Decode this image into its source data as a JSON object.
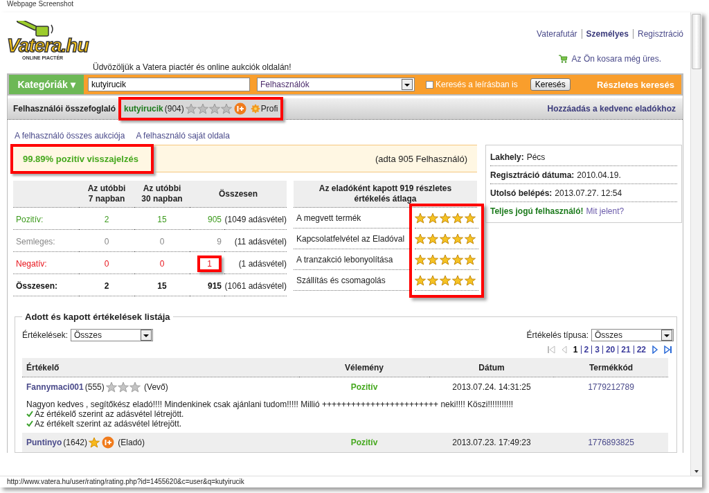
{
  "caption": "Webpage Screenshot",
  "logo": {
    "name": "Vatera.hu",
    "tagline": "ONLINE PIACTÉR"
  },
  "welcome": "Üdvözöljük a Vatera piactér és online aukciók oldalán!",
  "top_links": [
    {
      "label": "Vaterafutár",
      "bold": false
    },
    {
      "label": "Személyes",
      "bold": true
    },
    {
      "label": "Regisztráció",
      "bold": false
    }
  ],
  "cart": "Az Ön kosara még üres.",
  "search": {
    "categories": "Kategóriák ▾",
    "value": "kutyirucik",
    "scope": "Felhasználók",
    "description_checkbox": {
      "label": "Keresés a leírásban is",
      "checked": false
    },
    "button": "Keresés",
    "advanced": "Részletes keresés"
  },
  "summary": {
    "title": "Felhasználói összefoglaló",
    "highlighted": true,
    "user": "kutyirucik",
    "count": "(904)",
    "badges": [
      {
        "kind": "grey_star"
      },
      {
        "kind": "grey_star"
      },
      {
        "kind": "grey_star"
      },
      {
        "kind": "grey_star"
      },
      {
        "kind": "iplus"
      }
    ],
    "profi": "Profi",
    "favorite": "Hozzáadás a kedvenc eladókhoz"
  },
  "user_links": [
    "A felhasználó összes aukciója",
    "A felhasználó saját oldala"
  ],
  "feedback": {
    "headline": "99.89% pozitív visszajelzés",
    "highlighted": true,
    "given_by": "(adta 905 Felhasználó)"
  },
  "stats": {
    "columns": [
      "Az utóbbi 7 napban",
      "Az utóbbi 30 napban",
      "Összesen"
    ],
    "rows": [
      {
        "kind": "positive",
        "label": "Pozitív:",
        "d7": "2",
        "d30": "15",
        "total": "905",
        "sales": "(1049 adásvétel)",
        "highlighted": false
      },
      {
        "kind": "neutral",
        "label": "Semleges:",
        "d7": "0",
        "d30": "0",
        "total": "9",
        "sales": "(11 adásvétel)",
        "highlighted": false
      },
      {
        "kind": "negative",
        "label": "Negatív:",
        "d7": "0",
        "d30": "0",
        "total": "1",
        "sales": "(1 adásvétel)",
        "highlighted": true
      },
      {
        "kind": "total",
        "label": "Összesen:",
        "d7": "2",
        "d30": "15",
        "total": "915",
        "sales": "(1061 adásvétel)",
        "highlighted": false
      }
    ]
  },
  "ratings": {
    "title": "Az eladóként kapott 919 részletes értékelés átlaga",
    "highlighted": true,
    "rows": [
      {
        "label": "A megvett termék",
        "stars": 5
      },
      {
        "label": "Kapcsolatfelvétel az Eladóval",
        "stars": 5
      },
      {
        "label": "A tranzakció lebonyolítása",
        "stars": 5
      },
      {
        "label": "Szállítás és csomagolás",
        "stars": 5
      }
    ]
  },
  "profile": {
    "rows": [
      {
        "label": "Lakhely:",
        "value": "Pécs"
      },
      {
        "label": "Regisztráció dátuma:",
        "value": "2010.04.19."
      },
      {
        "label": "Utolsó belépés:",
        "value": "2013.07.27. 12:54"
      }
    ],
    "status": "Teljes jogú felhasználó!",
    "status_link": "Mit jelent?"
  },
  "list": {
    "title": "Adott és kapott értékelések listája",
    "filter": {
      "label": "Értékelések:",
      "value": "Összes"
    },
    "type_filter": {
      "label": "Értékelés típusa:",
      "value": "Összes"
    },
    "pages": [
      {
        "label": "1",
        "selected": true
      },
      {
        "label": "2",
        "selected": false
      },
      {
        "label": "3",
        "selected": false
      },
      {
        "label": "20",
        "selected": false
      },
      {
        "label": "21",
        "selected": false
      },
      {
        "label": "22",
        "selected": false
      }
    ],
    "columns": [
      "Értékelő",
      "Vélemény",
      "Dátum",
      "Termékkód"
    ],
    "rows": [
      {
        "user": "Fannymaci001",
        "count": "(555)",
        "badges": [
          {
            "kind": "silver_star"
          },
          {
            "kind": "silver_star"
          },
          {
            "kind": "silver_star"
          }
        ],
        "role": "(Vevő)",
        "opinion": "Pozitív",
        "date": "2013.07.24. 14:31:25",
        "code": "1779212789",
        "comment": "Nagyon kedves , segítőkész eladó!!!! Mindenkinek csak ajánlani tudom!!!!! Millió ++++++++++++++++++++++++ neki!!!! Köszi!!!!!!!!!!!",
        "confirmations": [
          "Az értékelő szerint az adásvétel létrejött.",
          "Az értékelt szerint az adásvétel létrejött."
        ]
      },
      {
        "user": "Puntinyo",
        "count": "(1642)",
        "badges": [
          {
            "kind": "gold_star"
          },
          {
            "kind": "iplus"
          }
        ],
        "role": "(Eladó)",
        "opinion": "Pozitív",
        "date": "2013.07.23. 17:49:23",
        "code": "1776893825"
      }
    ]
  },
  "status_bar": "http://www.vatera.hu/user/rating/rating.php?id=1455620&c=user&q=kutyirucik"
}
